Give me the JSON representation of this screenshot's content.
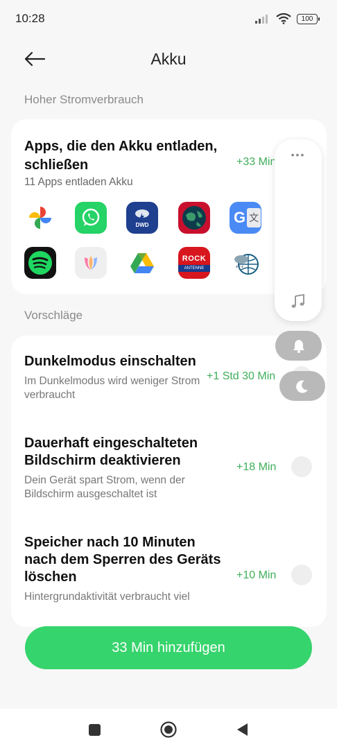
{
  "status_bar": {
    "time": "10:28",
    "battery": "100"
  },
  "header": {
    "title": "Akku"
  },
  "sections": {
    "high_usage": "Hoher Stromverbrauch",
    "suggestions": "Vorschläge"
  },
  "apps_card": {
    "title": "Apps, die den Akku entladen, schließen",
    "subtitle": "11 Apps entladen Akku",
    "gain": "+33 Min",
    "apps": [
      {
        "icon": "google-photos-icon"
      },
      {
        "icon": "whatsapp-icon"
      },
      {
        "icon": "dwd-warnwetter-icon",
        "label": "DWD"
      },
      {
        "icon": "earth-globe-icon"
      },
      {
        "icon": "google-translate-icon",
        "label": "G"
      },
      {
        "icon": "spotify-icon"
      },
      {
        "icon": "tulip-icon"
      },
      {
        "icon": "google-drive-icon"
      },
      {
        "icon": "rock-antenne-icon",
        "label": "ROCK",
        "sublabel": "ANTENNE"
      },
      {
        "icon": "weather-radar-icon"
      }
    ]
  },
  "suggestions": [
    {
      "title": "Dunkelmodus einschalten",
      "desc": "Im Dunkelmodus wird weniger Strom verbraucht",
      "gain": "+1 Std 30 Min"
    },
    {
      "title": "Dauerhaft eingeschalteten Bildschirm deaktivieren",
      "desc": "Dein Gerät spart Strom, wenn der Bildschirm ausgeschaltet ist",
      "gain": "+18 Min"
    },
    {
      "title": "Speicher nach 10 Minuten nach dem Sperren des Geräts löschen",
      "desc": "Hintergrundaktivität verbraucht viel",
      "gain": "+10 Min"
    }
  ],
  "cta": {
    "label": "33 Min  hinzufügen"
  },
  "floating_panel": {
    "dots": "•••"
  },
  "colors": {
    "accent_green": "#36d46c",
    "gain_green": "#3fae5a",
    "background": "#f7f7f7"
  }
}
